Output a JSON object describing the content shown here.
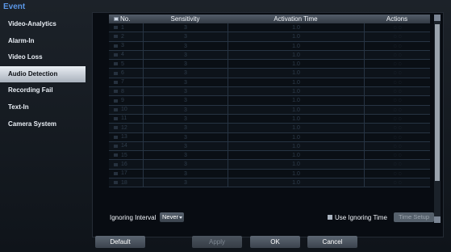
{
  "sidebar": {
    "title": "Event",
    "items": [
      {
        "label": "Video-Analytics",
        "active": false
      },
      {
        "label": "Alarm-In",
        "active": false
      },
      {
        "label": "Video Loss",
        "active": false
      },
      {
        "label": "Audio Detection",
        "active": true
      },
      {
        "label": "Recording Fail",
        "active": false
      },
      {
        "label": "Text-In",
        "active": false
      },
      {
        "label": "Camera System",
        "active": false
      }
    ]
  },
  "table": {
    "columns": [
      "No.",
      "Sensitivity",
      "Activation Time",
      "Actions"
    ],
    "rows": [
      {
        "no": "1",
        "sensitivity": "3",
        "activation_time": "1.0",
        "actions": "◌ ◌"
      },
      {
        "no": "2",
        "sensitivity": "3",
        "activation_time": "1.0",
        "actions": "◌ ◌"
      },
      {
        "no": "3",
        "sensitivity": "3",
        "activation_time": "1.0",
        "actions": "◌ ◌"
      },
      {
        "no": "4",
        "sensitivity": "3",
        "activation_time": "1.0",
        "actions": "◌ ◌"
      },
      {
        "no": "5",
        "sensitivity": "3",
        "activation_time": "1.0",
        "actions": "◌ ◌"
      },
      {
        "no": "6",
        "sensitivity": "3",
        "activation_time": "1.0",
        "actions": "◌ ◌"
      },
      {
        "no": "7",
        "sensitivity": "3",
        "activation_time": "1.0",
        "actions": "◌ ◌"
      },
      {
        "no": "8",
        "sensitivity": "3",
        "activation_time": "1.0",
        "actions": "◌ ◌"
      },
      {
        "no": "9",
        "sensitivity": "3",
        "activation_time": "1.0",
        "actions": "◌ ◌"
      },
      {
        "no": "10",
        "sensitivity": "3",
        "activation_time": "1.0",
        "actions": "◌ ◌"
      },
      {
        "no": "11",
        "sensitivity": "3",
        "activation_time": "1.0",
        "actions": "◌ ◌"
      },
      {
        "no": "12",
        "sensitivity": "3",
        "activation_time": "1.0",
        "actions": "◌ ◌"
      },
      {
        "no": "13",
        "sensitivity": "3",
        "activation_time": "1.0",
        "actions": "◌ ◌"
      },
      {
        "no": "14",
        "sensitivity": "3",
        "activation_time": "1.0",
        "actions": "◌ ◌"
      },
      {
        "no": "15",
        "sensitivity": "3",
        "activation_time": "1.0",
        "actions": "◌ ◌"
      },
      {
        "no": "16",
        "sensitivity": "3",
        "activation_time": "1.0",
        "actions": "◌ ◌"
      },
      {
        "no": "17",
        "sensitivity": "3",
        "activation_time": "1.0",
        "actions": "◌ ◌"
      },
      {
        "no": "18",
        "sensitivity": "3",
        "activation_time": "1.0",
        "actions": "◌ ◌"
      }
    ]
  },
  "ignoring": {
    "label": "Ignoring Interval",
    "value": "Never",
    "use_label": "Use Ignoring Time",
    "setup_label": "Time Setup"
  },
  "buttons": {
    "default": "Default",
    "apply": "Apply",
    "ok": "OK",
    "cancel": "Cancel"
  }
}
